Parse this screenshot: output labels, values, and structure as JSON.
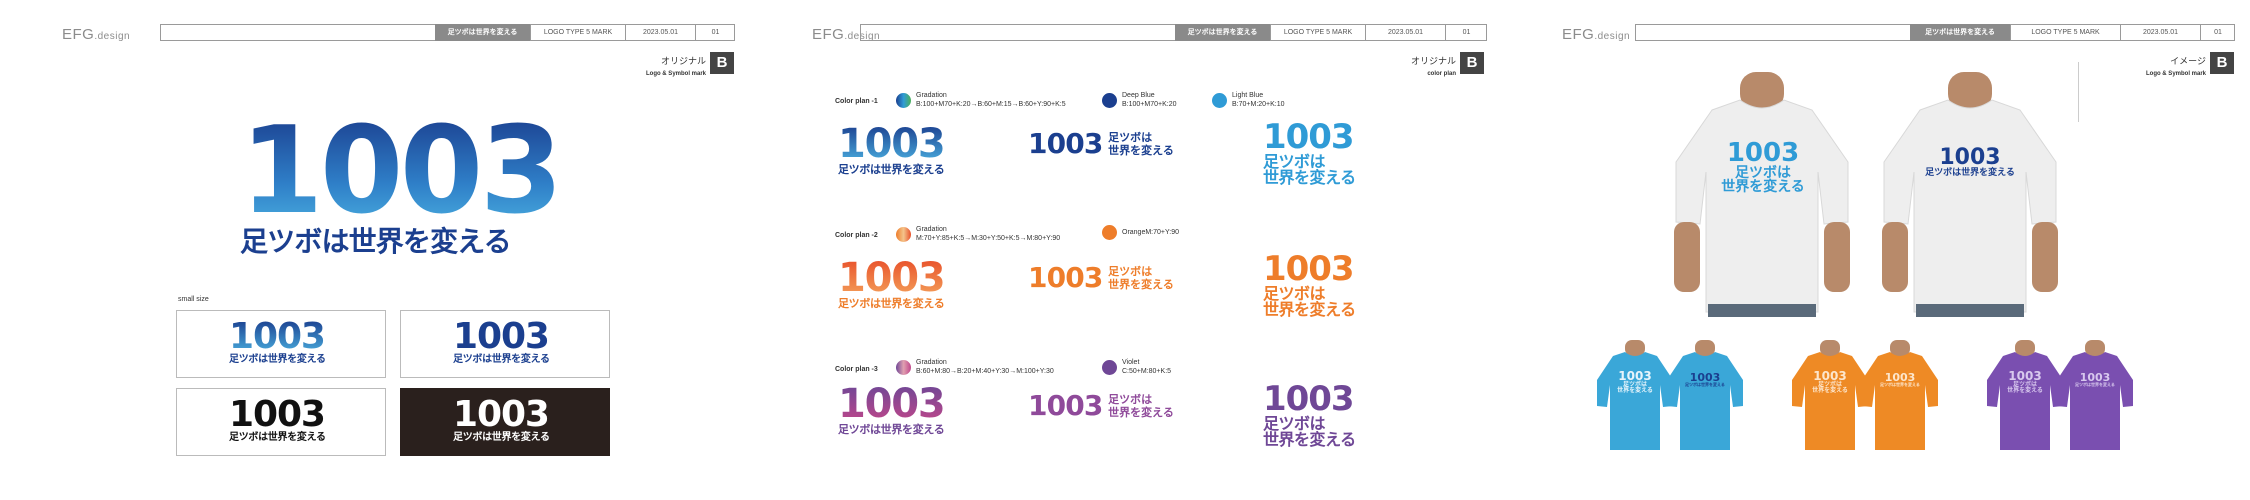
{
  "brand": {
    "main": "EFG",
    "sub": ".design"
  },
  "header": {
    "title": "足ツボは世界を変える",
    "type": "LOGO TYPE 5 MARK",
    "date": "2023.05.01",
    "page": "01"
  },
  "panels": [
    {
      "title_jp": "オリジナル",
      "title_en": "Logo & Symbol mark",
      "badge": "B"
    },
    {
      "title_jp": "オリジナル",
      "title_en": "color plan",
      "badge": "B"
    },
    {
      "title_jp": "イメージ",
      "title_en": "Logo & Symbol mark",
      "badge": "B"
    }
  ],
  "logo": {
    "number": "1003",
    "tagline": "足ツボは世界を変える",
    "tagline_l1": "足ツボは",
    "tagline_l2": "世界を変える"
  },
  "small_size_label": "small size",
  "color_plans": [
    {
      "label": "Color plan -1",
      "swatch1_name": "Gradation",
      "swatch1_spec": "B:100+M70+K:20→B:60+M:15→B:60+Y:90+K:5",
      "swatch2_name": "Deep Blue",
      "swatch2_spec": "B:100+M70+K:20",
      "swatch3_name": "Light Blue",
      "swatch3_spec": "B:70+M:20+K:10"
    },
    {
      "label": "Color plan -2",
      "swatch1_name": "Gradation",
      "swatch1_spec": "M:70+Y:85+K:5→M:30+Y:50+K:5→M:80+Y:90",
      "swatch2_name": "OrangeM:70+Y:90",
      "swatch2_spec": ""
    },
    {
      "label": "Color plan -3",
      "swatch1_name": "Gradation",
      "swatch1_spec": "B:60+M:80→B:20+M:40+Y:30→M:100+Y:30",
      "swatch2_name": "Violet",
      "swatch2_spec": "C:50+M:80+K:5"
    }
  ],
  "colors": {
    "deep_blue": "#1b3f8f",
    "light_blue": "#2f9bd6",
    "green": "#4bb05a",
    "orange": "#ee7d2a",
    "orange_light": "#f4a25b",
    "violet": "#6f4796",
    "magenta": "#c0478a",
    "dark_bg": "#2a201d",
    "shirt_white": "#eeeeee",
    "shirt_blue": "#3aa7d8",
    "shirt_orange": "#ee8a25",
    "shirt_violet": "#7a4fb0"
  }
}
